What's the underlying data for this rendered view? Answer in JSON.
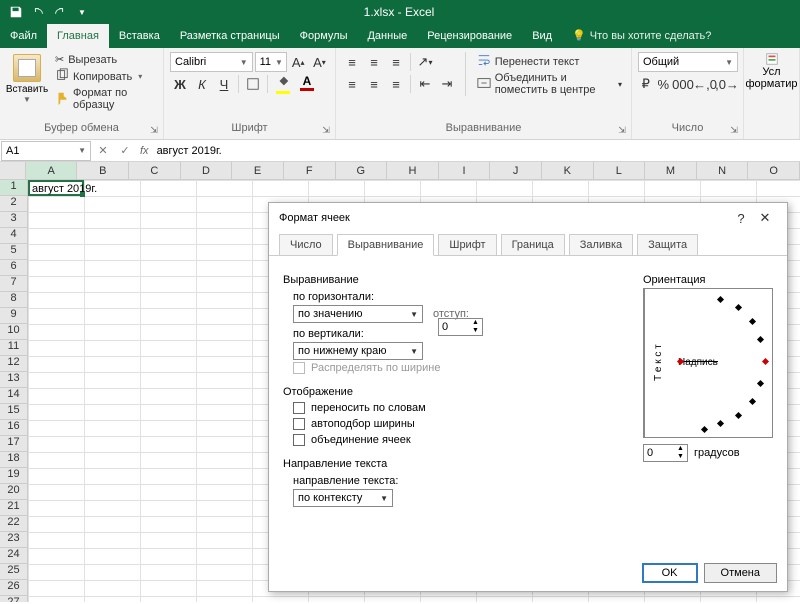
{
  "titlebar": {
    "title": "1.xlsx - Excel"
  },
  "menu": {
    "file": "Файл",
    "home": "Главная",
    "insert": "Вставка",
    "layout": "Разметка страницы",
    "formulas": "Формулы",
    "data": "Данные",
    "review": "Рецензирование",
    "view": "Вид",
    "tell": "Что вы хотите сделать?"
  },
  "ribbon": {
    "clipboard": {
      "paste": "Вставить",
      "cut": "Вырезать",
      "copy": "Копировать",
      "format": "Формат по образцу",
      "group": "Буфер обмена"
    },
    "font": {
      "family": "Calibri",
      "size": "11",
      "group": "Шрифт",
      "bold": "Ж",
      "italic": "К",
      "underline": "Ч"
    },
    "align": {
      "wrap": "Перенести текст",
      "merge": "Объединить и поместить в центре",
      "group": "Выравнивание"
    },
    "number": {
      "format": "Общий",
      "group": "Число"
    },
    "styles": {
      "cond": "Усл форматир"
    }
  },
  "formulabar": {
    "namebox": "A1",
    "fx": "fx",
    "value": "август 2019г."
  },
  "grid": {
    "cols": [
      "A",
      "B",
      "C",
      "D",
      "E",
      "F",
      "G",
      "H",
      "I",
      "J",
      "K",
      "L",
      "M",
      "N",
      "O"
    ],
    "rows": [
      "1",
      "2",
      "3",
      "4",
      "5",
      "6",
      "7",
      "8",
      "9",
      "10",
      "11",
      "12",
      "13",
      "14",
      "15",
      "16",
      "17",
      "18",
      "19",
      "20",
      "21",
      "22",
      "23",
      "24",
      "25",
      "26",
      "27"
    ],
    "a1": "август 2019г."
  },
  "dialog": {
    "title": "Формат ячеек",
    "tabs": {
      "number": "Число",
      "align": "Выравнивание",
      "font": "Шрифт",
      "border": "Граница",
      "fill": "Заливка",
      "protect": "Защита"
    },
    "sec_align": "Выравнивание",
    "h_label": "по горизонтали:",
    "h_value": "по значению",
    "indent_label": "отступ:",
    "indent_value": "0",
    "v_label": "по вертикали:",
    "v_value": "по нижнему краю",
    "distribute": "Распределять по ширине",
    "sec_display": "Отображение",
    "wrap": "переносить по словам",
    "shrink": "автоподбор ширины",
    "merge": "объединение ячеек",
    "sec_dir": "Направление текста",
    "dir_label": "направление текста:",
    "dir_value": "по контексту",
    "orient_label": "Ориентация",
    "orient_text": "Т е к с т",
    "orient_caption": "Надпись",
    "degrees": "0",
    "degrees_label": "градусов",
    "ok": "OK",
    "cancel": "Отмена"
  }
}
